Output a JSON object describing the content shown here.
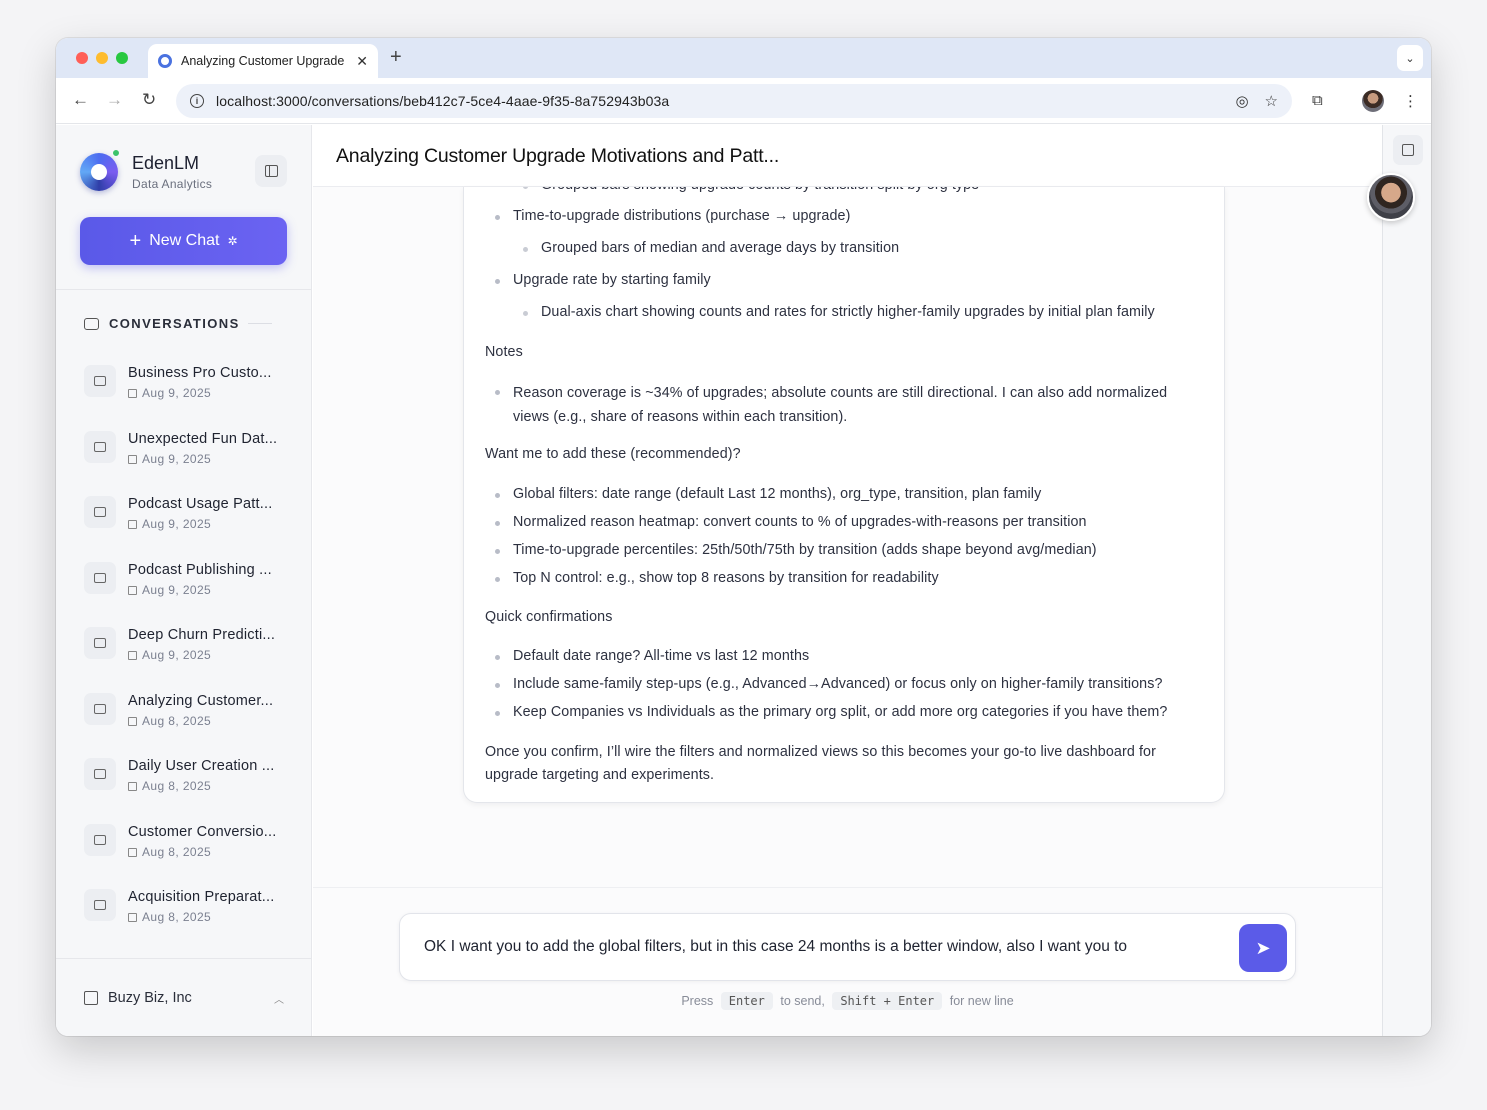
{
  "browser": {
    "tab_title": "Analyzing Customer Upgrade",
    "new_tab": "+",
    "url": "localhost:3000/conversations/beb412c7-5ce4-4aae-9f35-8a752943b03a"
  },
  "sidebar": {
    "brand_name": "EdenLM",
    "brand_subtitle": "Data Analytics",
    "new_chat_label": "New Chat",
    "conversations_header": "CONVERSATIONS",
    "conversations": [
      {
        "title": "Business Pro Custo...",
        "date": "Aug 9, 2025"
      },
      {
        "title": "Unexpected Fun Dat...",
        "date": "Aug 9, 2025"
      },
      {
        "title": "Podcast Usage Patt...",
        "date": "Aug 9, 2025"
      },
      {
        "title": "Podcast Publishing ...",
        "date": "Aug 9, 2025"
      },
      {
        "title": "Deep Churn Predicti...",
        "date": "Aug 9, 2025"
      },
      {
        "title": "Analyzing Customer...",
        "date": "Aug 8, 2025"
      },
      {
        "title": "Daily User Creation ...",
        "date": "Aug 8, 2025"
      },
      {
        "title": "Customer Conversio...",
        "date": "Aug 8, 2025"
      },
      {
        "title": "Acquisition Preparat...",
        "date": "Aug 8, 2025"
      }
    ],
    "org_name": "Buzy Biz, Inc"
  },
  "main": {
    "title": "Analyzing Customer Upgrade Motivations and Patt...",
    "message": {
      "l0": "Grouped bars showing upgrade counts by transition split by org type",
      "l1": "Time-to-upgrade distributions (purchase → upgrade)",
      "l2": "Grouped bars of median and average days by transition",
      "l3": "Upgrade rate by starting family",
      "l4": "Dual-axis chart showing counts and rates for strictly higher-family upgrades by initial plan family",
      "notes_heading": "Notes",
      "l5": "Reason coverage is ~34% of upgrades; absolute counts are still directional. I can also add normalized views (e.g., share of reasons within each transition).",
      "want_heading": "Want me to add these (recommended)?",
      "l6": "Global filters: date range (default Last 12 months), org_type, transition, plan family",
      "l7": "Normalized reason heatmap: convert counts to % of upgrades-with-reasons per transition",
      "l8": "Time-to-upgrade percentiles: 25th/50th/75th by transition (adds shape beyond avg/median)",
      "l9": "Top N control: e.g., show top 8 reasons by transition for readability",
      "quick_heading": "Quick confirmations",
      "l10": "Default date range? All-time vs last 12 months",
      "l11": "Include same-family step-ups (e.g., Advanced→Advanced) or focus only on higher-family transitions?",
      "l12": "Keep Companies vs Individuals as the primary org split, or add more org categories if you have them?",
      "closing": "Once you confirm, I’ll wire the filters and normalized views so this becomes your go-to live dashboard for upgrade targeting and experiments."
    },
    "composer_text": "OK I want you to add the global filters, but in this case 24 months is a better window, also I want you to",
    "hint": {
      "press": "Press",
      "enter": "Enter",
      "to_send": "to send,",
      "shift_enter": "Shift + Enter",
      "new_line": "for new line"
    }
  },
  "colors": {
    "accent": "#5b5be8",
    "online_dot": "#3cc36a"
  }
}
